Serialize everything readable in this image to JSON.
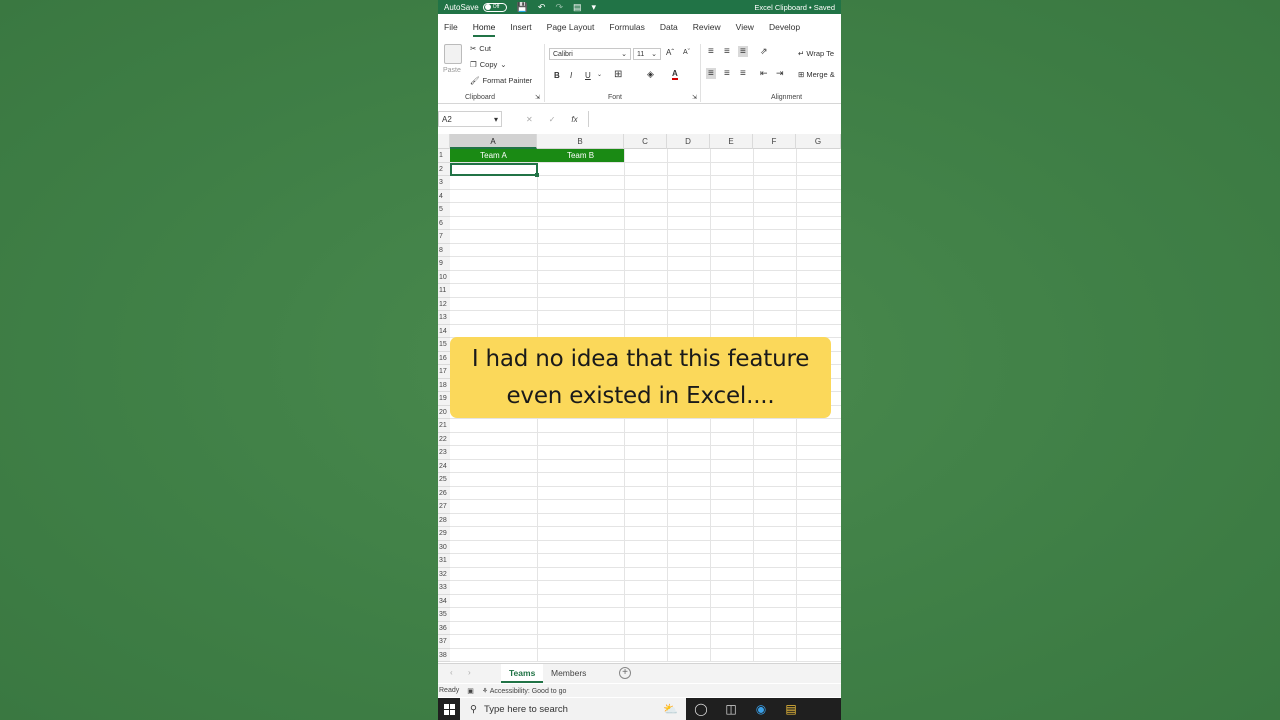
{
  "titlebar": {
    "autosave_label": "AutoSave",
    "autosave_state": "Off",
    "document_title": "Excel Clipboard • Saved"
  },
  "ribbon_tabs": [
    "File",
    "Home",
    "Insert",
    "Page Layout",
    "Formulas",
    "Data",
    "Review",
    "View",
    "Develop"
  ],
  "active_tab": "Home",
  "clipboard": {
    "paste_label": "Paste",
    "cut_label": "Cut",
    "copy_label": "Copy",
    "format_painter_label": "Format Painter",
    "group_label": "Clipboard"
  },
  "font": {
    "font_name": "Calibri",
    "font_size": "11",
    "bold": "B",
    "italic": "I",
    "underline": "U",
    "group_label": "Font"
  },
  "alignment": {
    "wrap_text_label": "Wrap Te",
    "merge_label": "Merge &",
    "group_label": "Alignment"
  },
  "formula_bar": {
    "name_box": "A2",
    "fx": "fx",
    "formula_value": ""
  },
  "columns": [
    "A",
    "B",
    "C",
    "D",
    "E",
    "F",
    "G"
  ],
  "rows": [
    "1",
    "2",
    "3",
    "4",
    "5",
    "6",
    "7",
    "8",
    "9",
    "10",
    "11",
    "12",
    "13",
    "14",
    "15",
    "16",
    "17",
    "18",
    "19",
    "20",
    "21",
    "22",
    "23",
    "24",
    "25",
    "26",
    "27",
    "28",
    "29",
    "30",
    "31",
    "32",
    "33",
    "34",
    "35",
    "36",
    "37",
    "38"
  ],
  "cells": {
    "A1": "Team A",
    "B1": "Team B"
  },
  "header_fill_color": "#1a8a14",
  "caption": {
    "line1": "I had no idea that this feature",
    "line2": "even existed in Excel...."
  },
  "sheets": [
    "Teams",
    "Members"
  ],
  "active_sheet": "Teams",
  "status": {
    "ready": "Ready",
    "accessibility": "Accessibility: Good to go"
  },
  "taskbar": {
    "search_placeholder": "Type here to search"
  }
}
